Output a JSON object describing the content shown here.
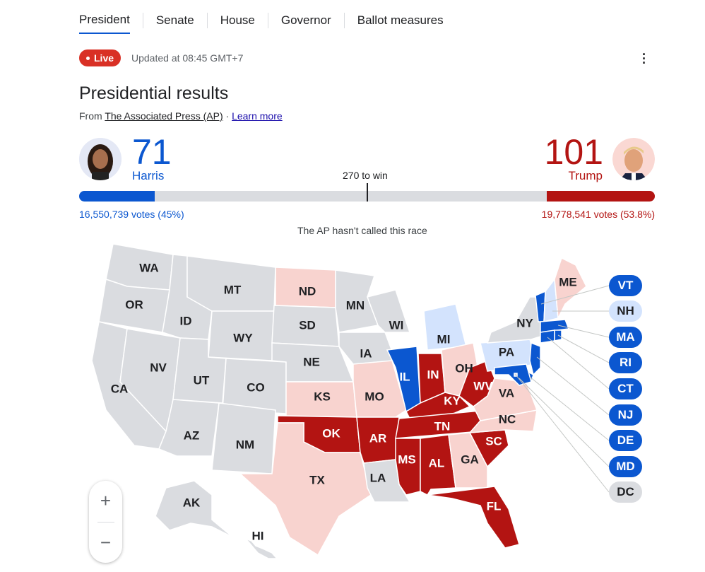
{
  "tabs": [
    "President",
    "Senate",
    "House",
    "Governor",
    "Ballot measures"
  ],
  "active_tab": "President",
  "live_label": "Live",
  "updated": "Updated at 08:45 GMT+7",
  "title": "Presidential results",
  "source": {
    "prefix": "From",
    "link": "The Associated Press (AP)",
    "sep": "·",
    "learn_more": "Learn more"
  },
  "harris": {
    "name": "Harris",
    "electoral_votes": "71",
    "votes": "16,550,739 votes (45%)",
    "bar_fraction": 0.1315
  },
  "trump": {
    "name": "Trump",
    "electoral_votes": "101",
    "votes": "19,778,541 votes (53.8%)",
    "bar_fraction": 0.1875
  },
  "to_win": "270 to win",
  "status": "The AP hasn't called this race",
  "colors": {
    "harris": "#0b57d0",
    "harris_leaning": "#d3e3fd",
    "trump": "#b31412",
    "trump_leaning": "#f8d3cf",
    "uncalled": "#dadce0"
  },
  "states": {
    "harris": [
      "IL",
      "VT",
      "MA",
      "RI",
      "CT",
      "NJ",
      "DE",
      "MD"
    ],
    "harris_leaning": [
      "MI",
      "NH",
      "PA"
    ],
    "trump": [
      "OK",
      "AR",
      "MS",
      "AL",
      "TN",
      "KY",
      "IN",
      "WV",
      "SC",
      "FL"
    ],
    "trump_leaning": [
      "ND",
      "KS",
      "MO",
      "TX",
      "OH",
      "VA",
      "NC",
      "GA",
      "ME"
    ],
    "uncalled": [
      "WA",
      "OR",
      "CA",
      "NV",
      "ID",
      "MT",
      "WY",
      "UT",
      "CO",
      "AZ",
      "NM",
      "SD",
      "NE",
      "MN",
      "IA",
      "WI",
      "LA",
      "NY",
      "AK",
      "HI",
      "DC"
    ]
  },
  "small_states": [
    "VT",
    "NH",
    "MA",
    "RI",
    "CT",
    "NJ",
    "DE",
    "MD",
    "DC"
  ],
  "zoom": {
    "in": "+",
    "out": "−"
  }
}
